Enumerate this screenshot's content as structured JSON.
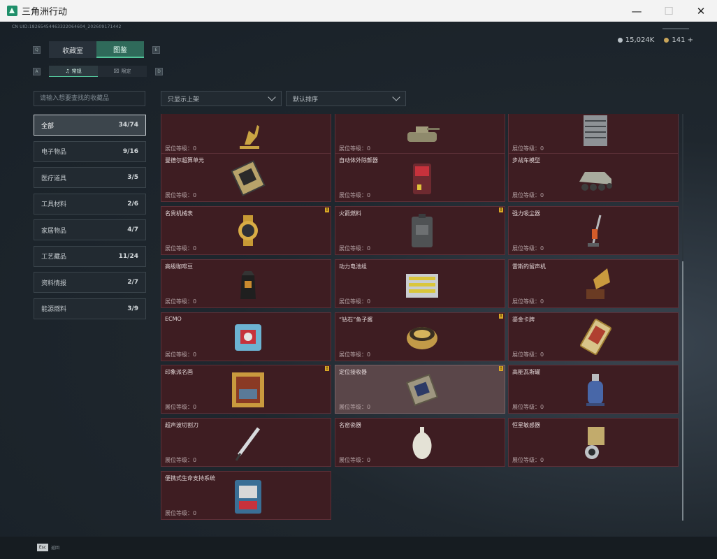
{
  "window": {
    "title": "三角洲行动",
    "minimize": "—",
    "maximize": "☐",
    "close": "✕"
  },
  "uid": "CN UID:18265454463322064604_202609171442",
  "currency": {
    "silver": "15,024K",
    "gold": "141 +"
  },
  "tabs": [
    {
      "label": "收藏室"
    },
    {
      "label": "图鉴"
    }
  ],
  "subtabs": [
    {
      "label": "常规"
    },
    {
      "label": "限定"
    }
  ],
  "keyhints": {
    "q": "Q",
    "e": "E",
    "a": "A",
    "d": "D"
  },
  "search": {
    "placeholder": "请输入想要查找的收藏品"
  },
  "filters": {
    "shelf": "只显示上架",
    "sort": "默认排序"
  },
  "categories": [
    {
      "label": "全部",
      "count": "34/74"
    },
    {
      "label": "电子物品",
      "count": "9/16"
    },
    {
      "label": "医疗道具",
      "count": "3/5"
    },
    {
      "label": "工具材料",
      "count": "2/6"
    },
    {
      "label": "家居物品",
      "count": "4/7"
    },
    {
      "label": "工艺藏品",
      "count": "11/24"
    },
    {
      "label": "资料情报",
      "count": "2/7"
    },
    {
      "label": "能源燃料",
      "count": "3/9"
    }
  ],
  "level_label": "展位等级：",
  "level_value": "0",
  "items": [
    {
      "name": "",
      "art": "deer-statue-icon",
      "alert": false
    },
    {
      "name": "",
      "art": "tank-model-icon",
      "alert": false
    },
    {
      "name": "",
      "art": "server-rack-icon",
      "alert": false
    },
    {
      "name": "曼德尔超算单元",
      "art": "supercomputer-unit-icon",
      "alert": false
    },
    {
      "name": "自动体外除颤器",
      "art": "defibrillator-icon",
      "alert": false
    },
    {
      "name": "步战车模型",
      "art": "ifv-model-icon",
      "alert": false
    },
    {
      "name": "名贵机械表",
      "art": "gold-watch-icon",
      "alert": true
    },
    {
      "name": "火箭燃料",
      "art": "fuel-canister-icon",
      "alert": true
    },
    {
      "name": "强力吸尘器",
      "art": "vacuum-cleaner-icon",
      "alert": false
    },
    {
      "name": "高级咖啡豆",
      "art": "coffee-bag-icon",
      "alert": false
    },
    {
      "name": "动力电池组",
      "art": "battery-pack-icon",
      "alert": false
    },
    {
      "name": "雷斯的留声机",
      "art": "gramophone-icon",
      "alert": false
    },
    {
      "name": "ECMO",
      "art": "ecmo-machine-icon",
      "alert": false
    },
    {
      "name": "“钻石”鱼子酱",
      "art": "caviar-tin-icon",
      "alert": true
    },
    {
      "name": "鎏金卡牌",
      "art": "gold-card-icon",
      "alert": false
    },
    {
      "name": "印象派名画",
      "art": "framed-painting-icon",
      "alert": true
    },
    {
      "name": "定位接收器",
      "art": "locator-receiver-icon",
      "alert": true
    },
    {
      "name": "高能瓦斯罐",
      "art": "gas-tank-icon",
      "alert": false
    },
    {
      "name": "超声波切割刀",
      "art": "ultrasonic-knife-icon",
      "alert": false
    },
    {
      "name": "名窑瓷器",
      "art": "porcelain-vase-icon",
      "alert": false
    },
    {
      "name": "恒星敏感器",
      "art": "star-sensor-icon",
      "alert": false
    },
    {
      "name": "便携式生命支持系统",
      "art": "life-support-icon",
      "alert": false
    }
  ],
  "bottom": {
    "esc_key": "Esc",
    "esc_label": "返回"
  }
}
